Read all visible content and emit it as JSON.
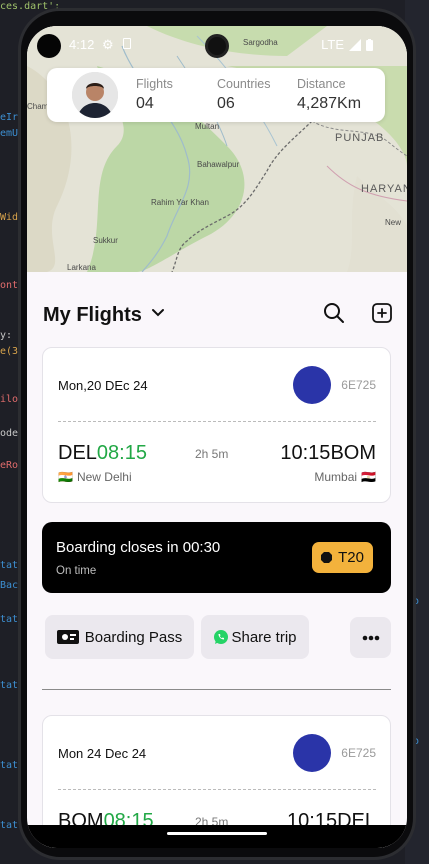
{
  "status_bar": {
    "time": "4:12",
    "network": "LTE"
  },
  "map": {
    "labels": [
      "Sargodha",
      "Multan",
      "Bahawalpur",
      "Rahim Yar Khan",
      "Sukkur",
      "Larkana",
      "PUNJAB",
      "HARYAN",
      "New",
      "Chami"
    ]
  },
  "stats": [
    {
      "label": "Flights",
      "value": "04"
    },
    {
      "label": "Countries",
      "value": "06"
    },
    {
      "label": "Distance",
      "value": "4,287Km"
    }
  ],
  "header": {
    "title": "My Flights"
  },
  "flights": [
    {
      "date": "Mon,20 DEc 24",
      "flight_code": "6E725",
      "from_code": "DEL",
      "depart_time": "08:15",
      "duration": "2h 5m",
      "arrive_time": "10:15",
      "to_code": "BOM",
      "from_city": "New Delhi",
      "to_city": "Mumbai",
      "from_flag": "🇮🇳",
      "to_flag": "🇪🇬"
    },
    {
      "date": "Mon 24 Dec 24",
      "flight_code": "6E725",
      "from_code": "BOM",
      "depart_time": "08:15",
      "duration": "2h 5m",
      "arrive_time": "10:15",
      "to_code": "DEL"
    }
  ],
  "boarding": {
    "title": "Boarding closes in 00:30",
    "subtitle": "On time",
    "gate": "T20"
  },
  "actions": {
    "boarding_pass": "Boarding Pass",
    "share_trip": "Share trip"
  },
  "colors": {
    "accent_green": "#22a846",
    "airline_logo": "#2a34a8",
    "gate_badge": "#f3b23c"
  }
}
